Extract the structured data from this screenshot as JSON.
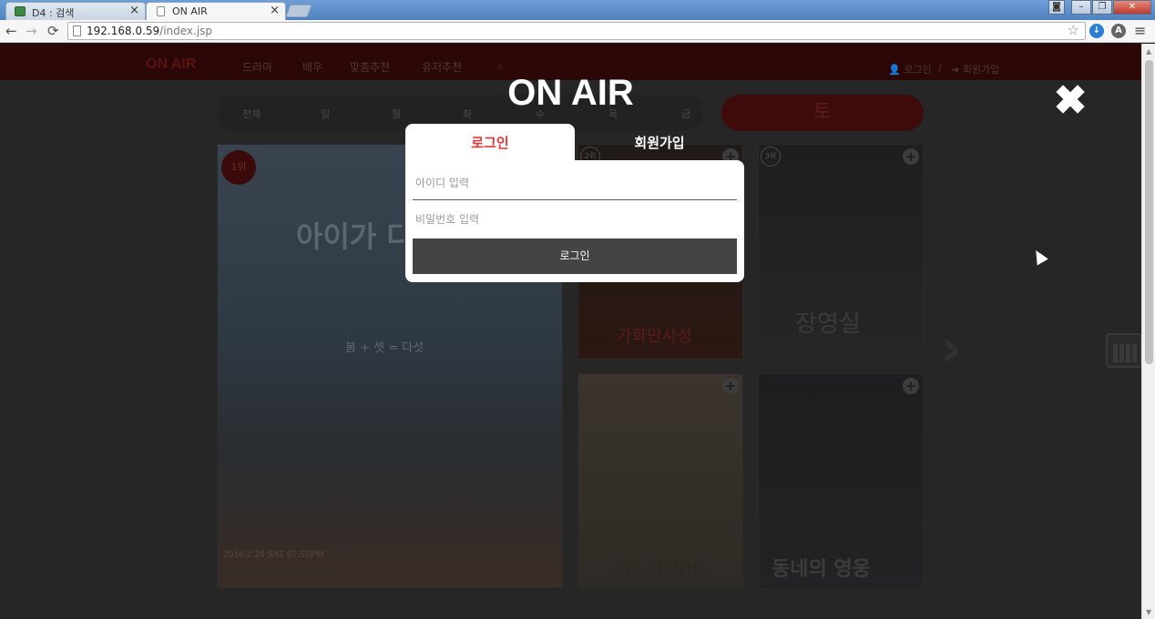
{
  "browser": {
    "tabs": [
      {
        "title": "D4 : 검색"
      },
      {
        "title": "ON AIR"
      }
    ],
    "tab_close": "×",
    "url_host": "192.168.0.59",
    "url_path": "/index.jsp",
    "nav": {
      "back": "←",
      "forward": "→",
      "reload": "⟳"
    },
    "star": "☆",
    "menu": "≡"
  },
  "site": {
    "logo": "ON AIR",
    "menu": [
      "드라마",
      "배우",
      "맞춤추천",
      "유저추천"
    ],
    "search_icon": "search-icon",
    "login_link": "로그인",
    "separator": "/",
    "join_link": "회원가입",
    "days": [
      "전체",
      "일",
      "월",
      "화",
      "수",
      "목",
      "금"
    ],
    "today": "토",
    "posters": [
      {
        "rank": "1위",
        "title": "아이가 다섯",
        "tagline": "봄 + 셋 = 다섯",
        "date": "2016.2.20 SAT 07:55PM"
      },
      {
        "rank": "2위",
        "title": "가화만사성"
      },
      {
        "rank": "3위",
        "title": "장영실"
      },
      {
        "rank": "",
        "title": "그래, 그런거야"
      },
      {
        "rank": "",
        "title": "동네의 영웅"
      }
    ]
  },
  "modal": {
    "title": "ON AIR",
    "close_icon": "close-icon",
    "tabs": {
      "login": "로그인",
      "join": "회원가입"
    },
    "id_placeholder": "아이디 입력",
    "pw_placeholder": "비밀번호 입력",
    "login_button": "로그인"
  }
}
